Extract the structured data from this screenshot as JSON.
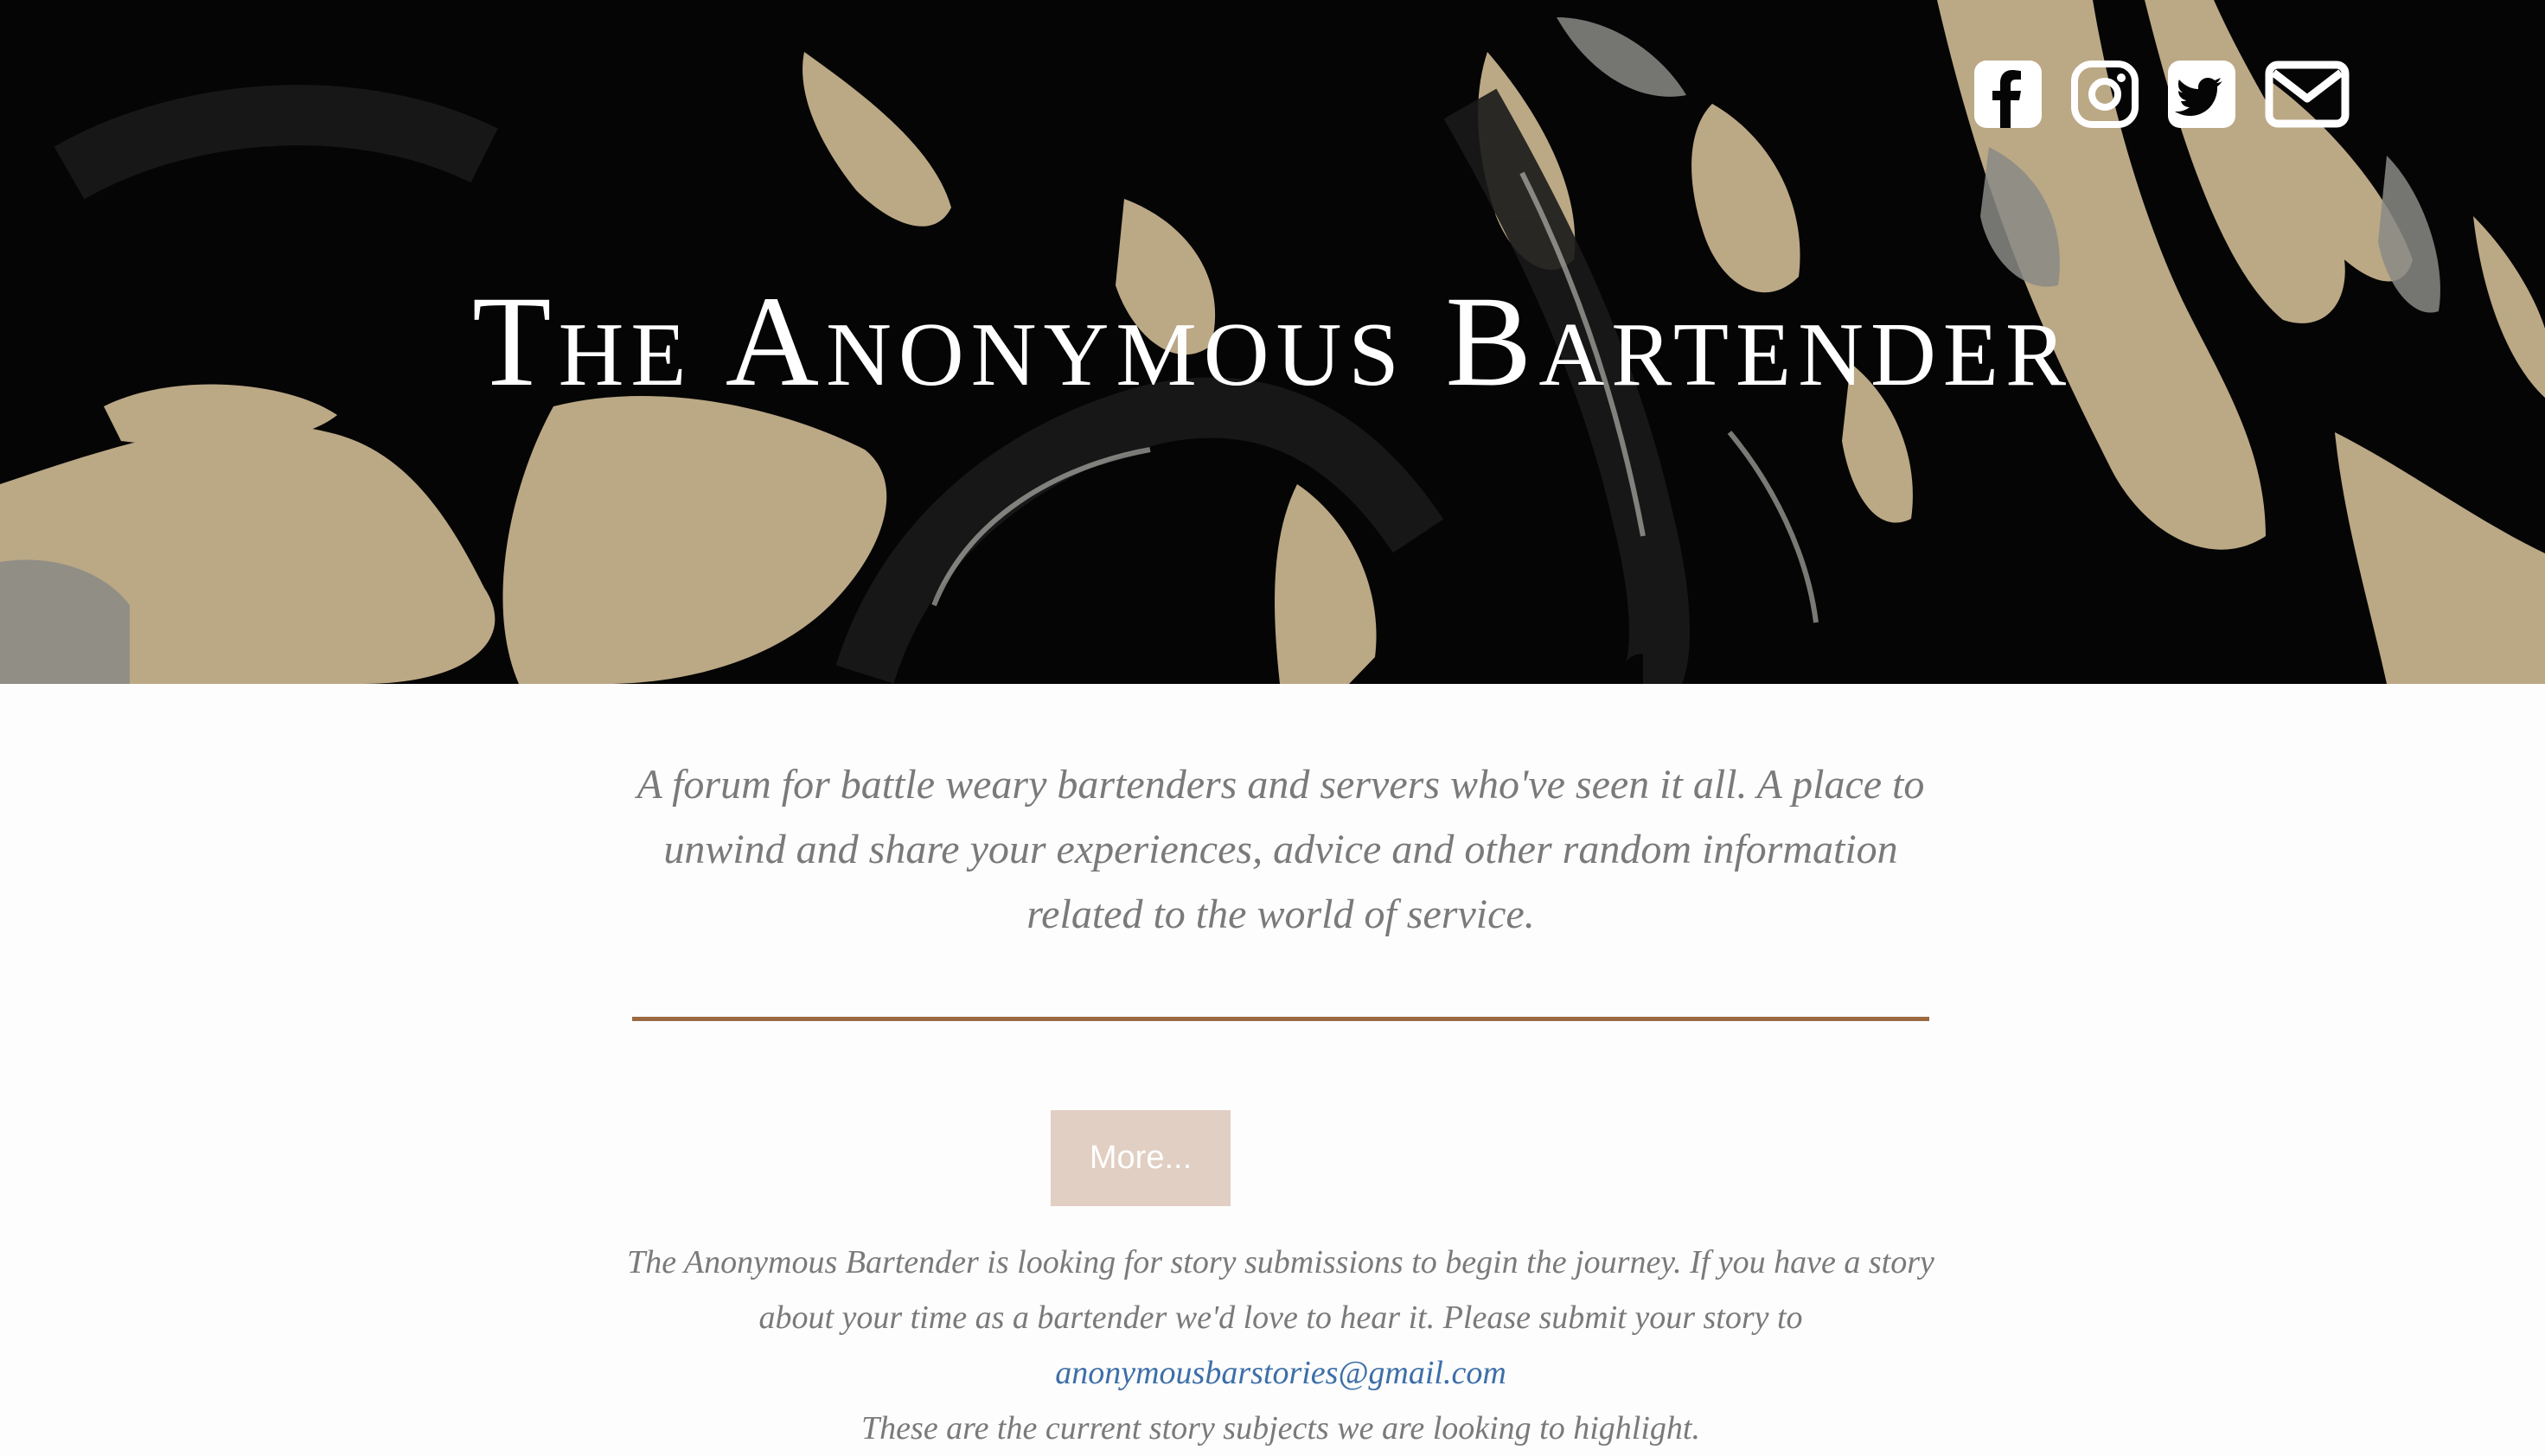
{
  "hero": {
    "title": "The Anonymous Bartender",
    "social_icons": [
      "facebook-icon",
      "instagram-icon",
      "twitter-icon",
      "email-icon"
    ]
  },
  "colors": {
    "accent_rule": "#9b6a43",
    "button_bg": "#e1cfc3",
    "link": "#3d6fa8",
    "hero_tan": "#bba885"
  },
  "main": {
    "tagline": "A forum for battle weary bartenders and servers who've seen it all. A place to unwind and share your experiences, advice and other random information related to the world of service.",
    "more_button": "More...",
    "submission_text": "The Anonymous Bartender is looking for story submissions to begin the journey. If you have a story about your time as a bartender we'd love to hear it. Please submit your story to",
    "submission_email": "anonymousbarstories@gmail.com",
    "subjects_line": "These are the current story subjects we are looking to highlight."
  }
}
